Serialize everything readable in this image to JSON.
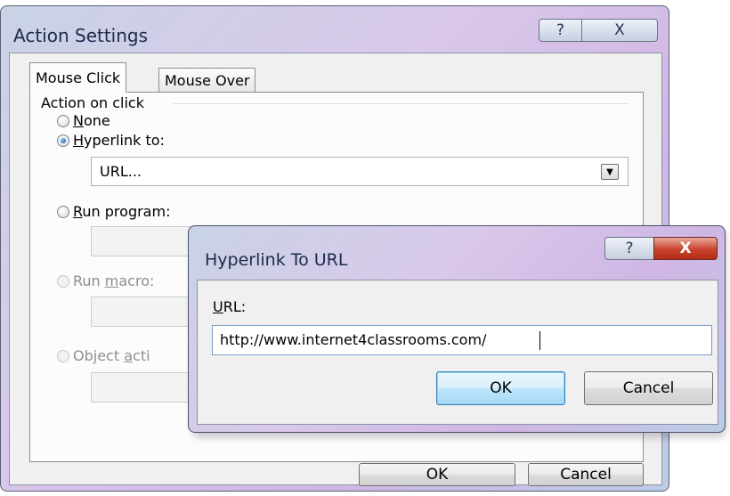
{
  "action_settings": {
    "title": "Action Settings",
    "help_glyph": "?",
    "close_glyph": "X",
    "tabs": [
      {
        "label": "Mouse Click"
      },
      {
        "label": "Mouse Over"
      }
    ],
    "group_label": "Action on click",
    "options": {
      "none": {
        "accel": "N",
        "rest": "one",
        "checked": false
      },
      "hyperlink": {
        "accel": "H",
        "rest": "yperlink to:",
        "checked": true
      },
      "run_program": {
        "accel": "R",
        "rest": "un program:",
        "checked": false
      },
      "run_macro": {
        "before": "Run ",
        "accel": "m",
        "rest": "acro:",
        "disabled": true
      },
      "object_action": {
        "before": "Object ",
        "accel": "a",
        "rest": "cti",
        "disabled": true
      }
    },
    "hyperlink_value": "URL...",
    "dropdown_icon": "chevron-down-icon",
    "ok_label": "OK",
    "cancel_label": "Cancel"
  },
  "hyperlink_dialog": {
    "title": "Hyperlink To URL",
    "help_glyph": "?",
    "close_glyph": "X",
    "url_label_accel": "U",
    "url_label_rest": "RL:",
    "url_value": "http://www.internet4classrooms.com/",
    "ok_label": "OK",
    "cancel_label": "Cancel"
  },
  "colors": {
    "title_text": "#1c2a4e",
    "close_button": "#c8432c",
    "default_button": "#3c7fb1"
  }
}
